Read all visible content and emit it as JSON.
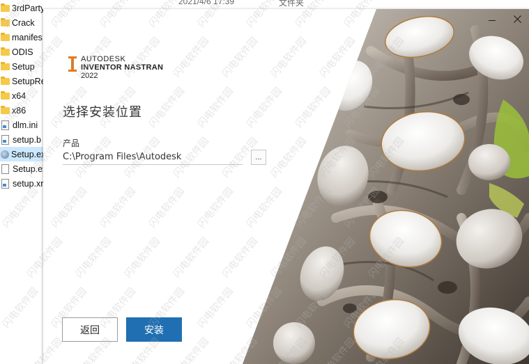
{
  "explorer": {
    "header_date": "2021/4/6 17:39",
    "header_type": "文件夹",
    "files": [
      {
        "name": "3rdParty",
        "icon": "folder-icon"
      },
      {
        "name": "Crack",
        "icon": "folder-icon"
      },
      {
        "name": "manifes",
        "icon": "folder-icon"
      },
      {
        "name": "ODIS",
        "icon": "folder-icon"
      },
      {
        "name": "Setup",
        "icon": "folder-icon"
      },
      {
        "name": "SetupRe",
        "icon": "folder-icon"
      },
      {
        "name": "x64",
        "icon": "folder-icon"
      },
      {
        "name": "x86",
        "icon": "folder-icon"
      },
      {
        "name": "dlm.ini",
        "icon": "settings-file-icon"
      },
      {
        "name": "setup.b",
        "icon": "settings-file-icon"
      },
      {
        "name": "Setup.ex",
        "icon": "exe-icon"
      },
      {
        "name": "Setup.ex",
        "icon": "file-icon"
      },
      {
        "name": "setup.xr",
        "icon": "settings-file-icon"
      }
    ]
  },
  "installer": {
    "brand": {
      "company": "AUTODESK",
      "product": "INVENTOR NASTRAN",
      "year": "2022"
    },
    "heading": "选择安装位置",
    "field_label": "产品",
    "path_value": "C:\\Program Files\\Autodesk",
    "browse_label": "...",
    "back_label": "返回",
    "install_label": "安装",
    "accent_color": "#1f6fb2",
    "brand_color": "#e07b25"
  },
  "watermark_text": "闪电软件园"
}
